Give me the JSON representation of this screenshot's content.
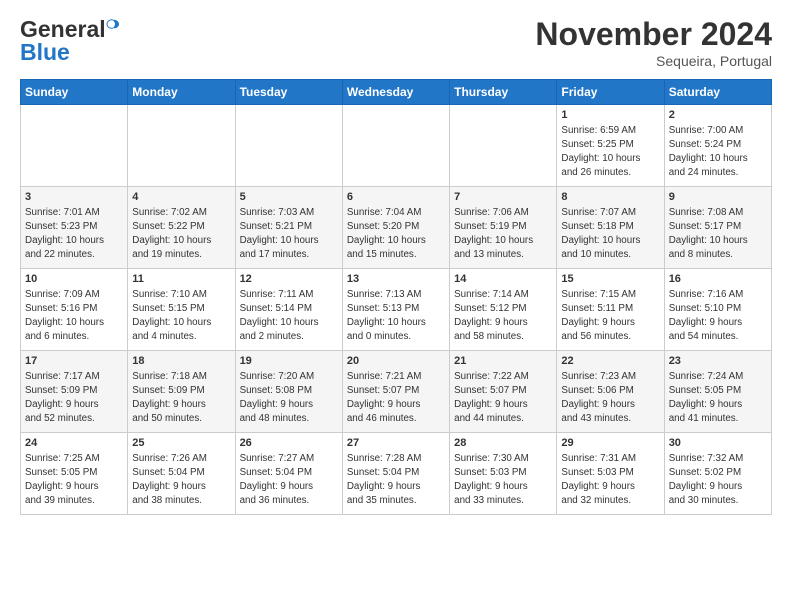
{
  "logo": {
    "general": "General",
    "blue": "Blue"
  },
  "header": {
    "month": "November 2024",
    "location": "Sequeira, Portugal"
  },
  "weekdays": [
    "Sunday",
    "Monday",
    "Tuesday",
    "Wednesday",
    "Thursday",
    "Friday",
    "Saturday"
  ],
  "weeks": [
    [
      {
        "day": "",
        "info": ""
      },
      {
        "day": "",
        "info": ""
      },
      {
        "day": "",
        "info": ""
      },
      {
        "day": "",
        "info": ""
      },
      {
        "day": "",
        "info": ""
      },
      {
        "day": "1",
        "info": "Sunrise: 6:59 AM\nSunset: 5:25 PM\nDaylight: 10 hours\nand 26 minutes."
      },
      {
        "day": "2",
        "info": "Sunrise: 7:00 AM\nSunset: 5:24 PM\nDaylight: 10 hours\nand 24 minutes."
      }
    ],
    [
      {
        "day": "3",
        "info": "Sunrise: 7:01 AM\nSunset: 5:23 PM\nDaylight: 10 hours\nand 22 minutes."
      },
      {
        "day": "4",
        "info": "Sunrise: 7:02 AM\nSunset: 5:22 PM\nDaylight: 10 hours\nand 19 minutes."
      },
      {
        "day": "5",
        "info": "Sunrise: 7:03 AM\nSunset: 5:21 PM\nDaylight: 10 hours\nand 17 minutes."
      },
      {
        "day": "6",
        "info": "Sunrise: 7:04 AM\nSunset: 5:20 PM\nDaylight: 10 hours\nand 15 minutes."
      },
      {
        "day": "7",
        "info": "Sunrise: 7:06 AM\nSunset: 5:19 PM\nDaylight: 10 hours\nand 13 minutes."
      },
      {
        "day": "8",
        "info": "Sunrise: 7:07 AM\nSunset: 5:18 PM\nDaylight: 10 hours\nand 10 minutes."
      },
      {
        "day": "9",
        "info": "Sunrise: 7:08 AM\nSunset: 5:17 PM\nDaylight: 10 hours\nand 8 minutes."
      }
    ],
    [
      {
        "day": "10",
        "info": "Sunrise: 7:09 AM\nSunset: 5:16 PM\nDaylight: 10 hours\nand 6 minutes."
      },
      {
        "day": "11",
        "info": "Sunrise: 7:10 AM\nSunset: 5:15 PM\nDaylight: 10 hours\nand 4 minutes."
      },
      {
        "day": "12",
        "info": "Sunrise: 7:11 AM\nSunset: 5:14 PM\nDaylight: 10 hours\nand 2 minutes."
      },
      {
        "day": "13",
        "info": "Sunrise: 7:13 AM\nSunset: 5:13 PM\nDaylight: 10 hours\nand 0 minutes."
      },
      {
        "day": "14",
        "info": "Sunrise: 7:14 AM\nSunset: 5:12 PM\nDaylight: 9 hours\nand 58 minutes."
      },
      {
        "day": "15",
        "info": "Sunrise: 7:15 AM\nSunset: 5:11 PM\nDaylight: 9 hours\nand 56 minutes."
      },
      {
        "day": "16",
        "info": "Sunrise: 7:16 AM\nSunset: 5:10 PM\nDaylight: 9 hours\nand 54 minutes."
      }
    ],
    [
      {
        "day": "17",
        "info": "Sunrise: 7:17 AM\nSunset: 5:09 PM\nDaylight: 9 hours\nand 52 minutes."
      },
      {
        "day": "18",
        "info": "Sunrise: 7:18 AM\nSunset: 5:09 PM\nDaylight: 9 hours\nand 50 minutes."
      },
      {
        "day": "19",
        "info": "Sunrise: 7:20 AM\nSunset: 5:08 PM\nDaylight: 9 hours\nand 48 minutes."
      },
      {
        "day": "20",
        "info": "Sunrise: 7:21 AM\nSunset: 5:07 PM\nDaylight: 9 hours\nand 46 minutes."
      },
      {
        "day": "21",
        "info": "Sunrise: 7:22 AM\nSunset: 5:07 PM\nDaylight: 9 hours\nand 44 minutes."
      },
      {
        "day": "22",
        "info": "Sunrise: 7:23 AM\nSunset: 5:06 PM\nDaylight: 9 hours\nand 43 minutes."
      },
      {
        "day": "23",
        "info": "Sunrise: 7:24 AM\nSunset: 5:05 PM\nDaylight: 9 hours\nand 41 minutes."
      }
    ],
    [
      {
        "day": "24",
        "info": "Sunrise: 7:25 AM\nSunset: 5:05 PM\nDaylight: 9 hours\nand 39 minutes."
      },
      {
        "day": "25",
        "info": "Sunrise: 7:26 AM\nSunset: 5:04 PM\nDaylight: 9 hours\nand 38 minutes."
      },
      {
        "day": "26",
        "info": "Sunrise: 7:27 AM\nSunset: 5:04 PM\nDaylight: 9 hours\nand 36 minutes."
      },
      {
        "day": "27",
        "info": "Sunrise: 7:28 AM\nSunset: 5:04 PM\nDaylight: 9 hours\nand 35 minutes."
      },
      {
        "day": "28",
        "info": "Sunrise: 7:30 AM\nSunset: 5:03 PM\nDaylight: 9 hours\nand 33 minutes."
      },
      {
        "day": "29",
        "info": "Sunrise: 7:31 AM\nSunset: 5:03 PM\nDaylight: 9 hours\nand 32 minutes."
      },
      {
        "day": "30",
        "info": "Sunrise: 7:32 AM\nSunset: 5:02 PM\nDaylight: 9 hours\nand 30 minutes."
      }
    ]
  ]
}
